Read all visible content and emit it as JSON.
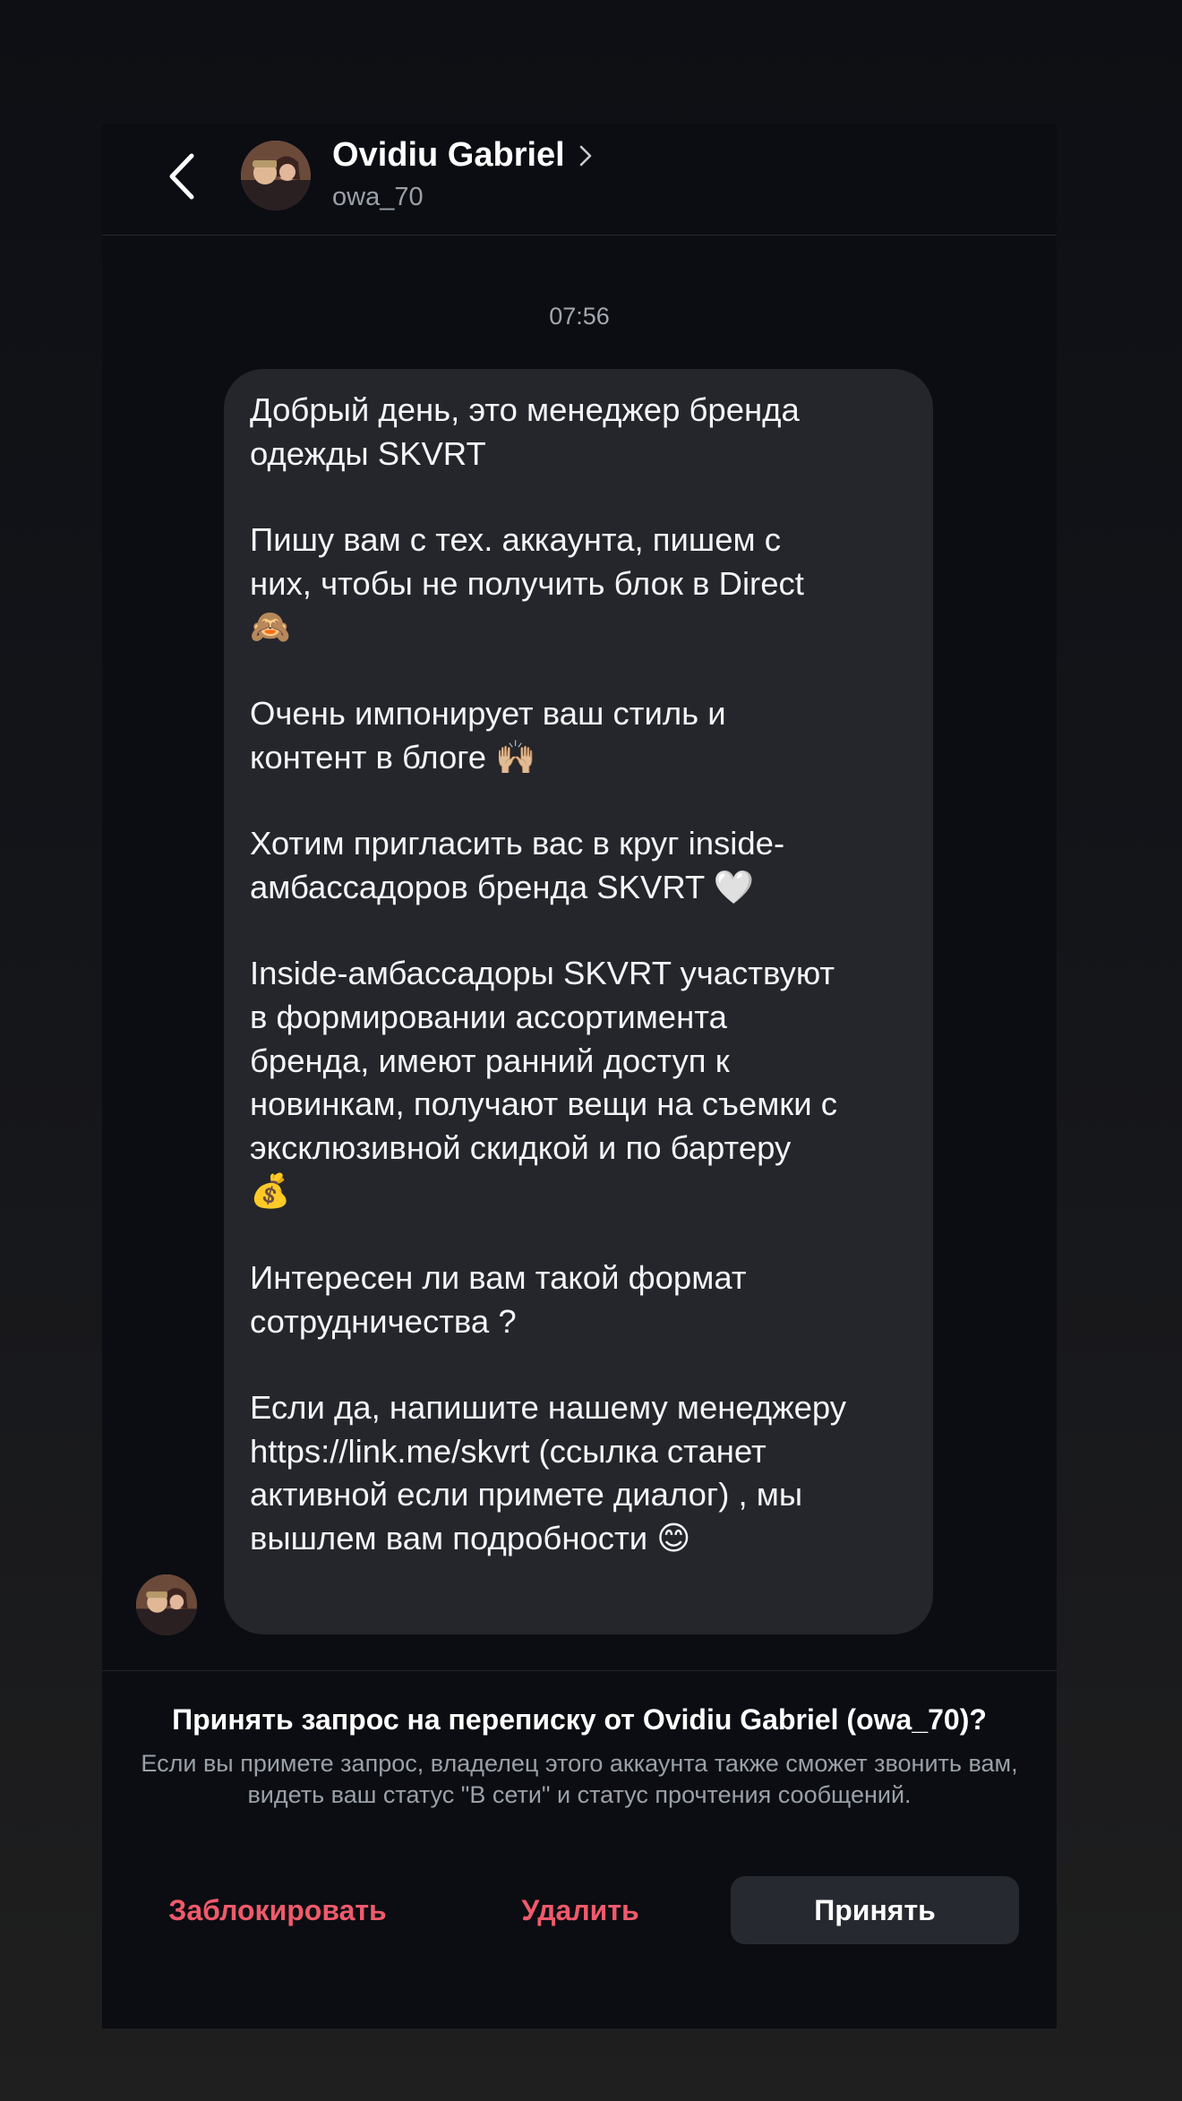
{
  "header": {
    "contact_name": "Ovidiu Gabriel",
    "username": "owa_70",
    "back_icon": "chevron-left-icon",
    "profile_chevron_icon": "chevron-right-icon"
  },
  "thread": {
    "timestamp": "07:56",
    "message": {
      "paragraphs": [
        "Добрый день, это менеджер бренда\nодежды SKVRT",
        "Пишу вам с тех. аккаунта, пишем с\nних, чтобы не получить блок в Direct\n🙈",
        "Очень импонирует ваш стиль и\nконтент в блоге 🙌🏼",
        "Хотим пригласить вас в круг inside-\nамбассадоров бренда SKVRT  🤍",
        "Inside-амбассадоры SKVRT участвуют\nв формировании ассортимента\nбренда, имеют ранний доступ к\nновинкам, получают вещи на съемки с\nэксклюзивной скидкой и по бартеру\n💰",
        "Интересен ли вам такой формат\nсотрудничества ?",
        "Если да, напишите нашему менеджеру\nhttps://link.me/skvrt (ссылка станет\nактивной если примете диалог) , мы\nвышлем вам подробности 😊"
      ]
    }
  },
  "request": {
    "title": "Принять запрос на переписку от Ovidiu Gabriel (owa_70)?",
    "description": "Если вы примете запрос, владелец этого аккаунта также сможет звонить вам, видеть ваш статус \"В сети\" и статус прочтения сообщений.",
    "block_label": "Заблокировать",
    "delete_label": "Удалить",
    "accept_label": "Принять"
  },
  "colors": {
    "background": "#0b0d12",
    "bubble": "#24262b",
    "destructive": "#f05a6b",
    "accept_button": "#26292f",
    "secondary_text": "#9aa0a8"
  }
}
